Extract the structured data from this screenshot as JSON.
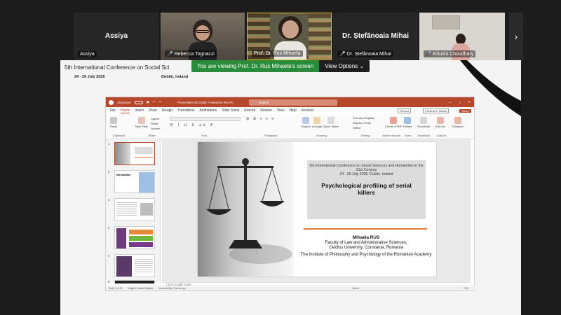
{
  "participants": [
    {
      "name": "Assiya",
      "big_label": "Assiya"
    },
    {
      "name": "Rebecca Tognazzi"
    },
    {
      "name": "Prof. Dr. Rus Mihaela"
    },
    {
      "name": "Dr. Ștefănoaia Mihai",
      "big_label": "Dr. Ștefănoaia Mihai"
    },
    {
      "name": "Khushi Choudhary"
    }
  ],
  "banner": {
    "text": "You are viewing  Prof. Dr. Rus Mihaela's screen",
    "view_options": "View Options"
  },
  "conference_header": {
    "title": "5th International Conference on Social Sci",
    "dates": "24 - 26 July 2026",
    "place": "Dublin, Ireland"
  },
  "ppt": {
    "autosave": "AutoSave",
    "filename": "Prezentare 02 Dublin • Saved to this PC",
    "search": "Search",
    "menu": [
      "File",
      "Home",
      "Insert",
      "Draw",
      "Design",
      "Transitions",
      "Animations",
      "Slide Show",
      "Record",
      "Review",
      "View",
      "Help",
      "Acrobat"
    ],
    "actions": {
      "record": "Record",
      "present": "Present in Teams",
      "share": "Share"
    },
    "ribbon_groups": {
      "clipboard": "Clipboard",
      "slides": "Slides",
      "font": "Font",
      "paragraph": "Paragraph",
      "drawing": "Drawing",
      "editing": "Editing",
      "adobe": "Adobe Acrobat",
      "voice": "Voice",
      "sensitivity": "Sensitivity",
      "addins": "Add-ins"
    },
    "ribbon_buttons": {
      "paste": "Paste",
      "new_slide": "New Slide",
      "layout": "Layout",
      "reset": "Reset",
      "section": "Section",
      "shapes": "Shapes",
      "arrange": "Arrange",
      "quick_styles": "Quick Styles",
      "find_replace": "Find and Replace",
      "replace_fonts": "Replace Fonts",
      "select": "Select",
      "create_pdf": "Create a PDF",
      "dictate": "Dictate",
      "sensitivity": "Sensitivity",
      "addins": "Add-ins",
      "designer": "Designer"
    },
    "thumb_numbers": [
      "1",
      "2",
      "3",
      "4",
      "5",
      "6"
    ],
    "thumb_text": {
      "t2": "Introduction"
    },
    "notes_placeholder": "Click to add notes",
    "status": {
      "slide": "Slide 1 of 15",
      "language": "English (United States)",
      "accessibility": "Accessibility: Good to go",
      "notes": "Notes",
      "zoom": "79%"
    }
  },
  "slide": {
    "conference": "5th International Conference on Social Sciences and Humanities in the 21st Century",
    "dates_place": "24 - 26 July 2026. Dublin, Ireland",
    "title": "Psychological profiling of serial killers",
    "author": "Mihaela RUS",
    "affil1_a": "Faculty of Law and Administrative Sciences,",
    "affil1_b": "Ovidius",
    "affil1_c": " University, Constanța, Romania",
    "affil2": "The Institute of Philosophy and Psychology of the Romanian Academy"
  },
  "colors": {
    "ppt_accent": "#b7472a",
    "banner_green": "#2a8c3a",
    "slide_line": "#e07a3a"
  }
}
